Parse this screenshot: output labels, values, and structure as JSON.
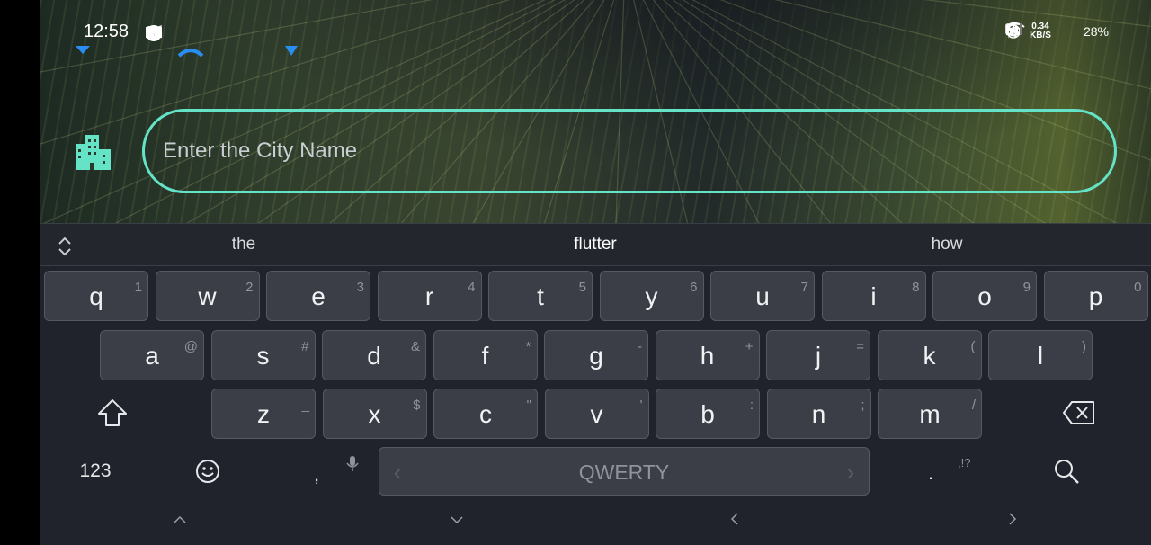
{
  "status_bar": {
    "time": "12:58",
    "net_speed_value": "0.34",
    "net_speed_unit": "KB/S",
    "battery": "28%"
  },
  "city_input": {
    "placeholder": "Enter the City Name",
    "value": ""
  },
  "suggestions": [
    "the",
    "flutter",
    "how"
  ],
  "keyboard": {
    "row1": [
      {
        "key": "q",
        "hint": "1"
      },
      {
        "key": "w",
        "hint": "2"
      },
      {
        "key": "e",
        "hint": "3"
      },
      {
        "key": "r",
        "hint": "4"
      },
      {
        "key": "t",
        "hint": "5"
      },
      {
        "key": "y",
        "hint": "6"
      },
      {
        "key": "u",
        "hint": "7"
      },
      {
        "key": "i",
        "hint": "8"
      },
      {
        "key": "o",
        "hint": "9"
      },
      {
        "key": "p",
        "hint": "0"
      }
    ],
    "row2": [
      {
        "key": "a",
        "hint": "@"
      },
      {
        "key": "s",
        "hint": "#"
      },
      {
        "key": "d",
        "hint": "&"
      },
      {
        "key": "f",
        "hint": "*"
      },
      {
        "key": "g",
        "hint": "-"
      },
      {
        "key": "h",
        "hint": "+"
      },
      {
        "key": "j",
        "hint": "="
      },
      {
        "key": "k",
        "hint": "("
      },
      {
        "key": "l",
        "hint": ")"
      }
    ],
    "row3": [
      {
        "key": "z",
        "hint": "_"
      },
      {
        "key": "x",
        "hint": "$"
      },
      {
        "key": "c",
        "hint": "\""
      },
      {
        "key": "v",
        "hint": "'"
      },
      {
        "key": "b",
        "hint": ":"
      },
      {
        "key": "n",
        "hint": ";"
      },
      {
        "key": "m",
        "hint": "/"
      }
    ],
    "numbers_label": "123",
    "comma": ",",
    "space_label": "QWERTY",
    "period": ".",
    "punct_hint": ",!?"
  },
  "icons": {
    "city": "city-buildings-icon",
    "shift": "shift-icon",
    "backspace": "backspace-icon",
    "emoji": "emoji-icon",
    "mic": "mic-icon",
    "search": "search-icon"
  },
  "colors": {
    "accent": "#64e3c6",
    "keyboard_bg": "#20232b",
    "key_bg": "#3b3e46"
  }
}
